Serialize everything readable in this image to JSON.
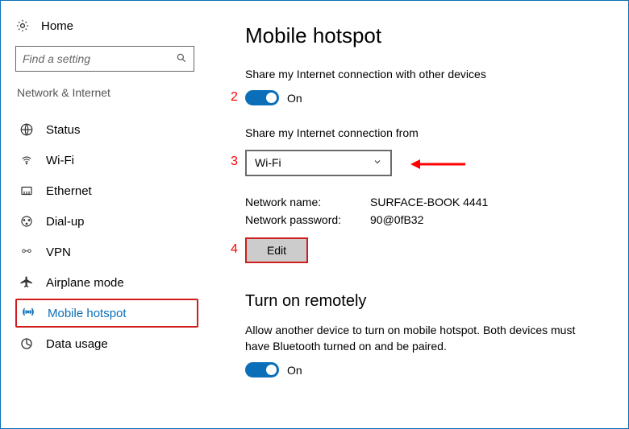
{
  "sidebar": {
    "home_label": "Home",
    "search_placeholder": "Find a setting",
    "category": "Network & Internet",
    "items": [
      {
        "label": "Status"
      },
      {
        "label": "Wi-Fi"
      },
      {
        "label": "Ethernet"
      },
      {
        "label": "Dial-up"
      },
      {
        "label": "VPN"
      },
      {
        "label": "Airplane mode"
      },
      {
        "label": "Mobile hotspot"
      },
      {
        "label": "Data usage"
      }
    ]
  },
  "main": {
    "title": "Mobile hotspot",
    "share_text": "Share my Internet connection with other devices",
    "toggle_state": "On",
    "share_from_label": "Share my Internet connection from",
    "dropdown_value": "Wi-Fi",
    "network_name_label": "Network name:",
    "network_name_value": "SURFACE-BOOK 4441",
    "network_password_label": "Network password:",
    "network_password_value": "90@0fB32",
    "edit_label": "Edit",
    "remote_title": "Turn on remotely",
    "remote_text": "Allow another device to turn on mobile hotspot. Both devices must have Bluetooth turned on and be paired.",
    "remote_toggle_state": "On"
  },
  "annotations": {
    "marker2": "2",
    "marker3": "3",
    "marker4": "4"
  }
}
